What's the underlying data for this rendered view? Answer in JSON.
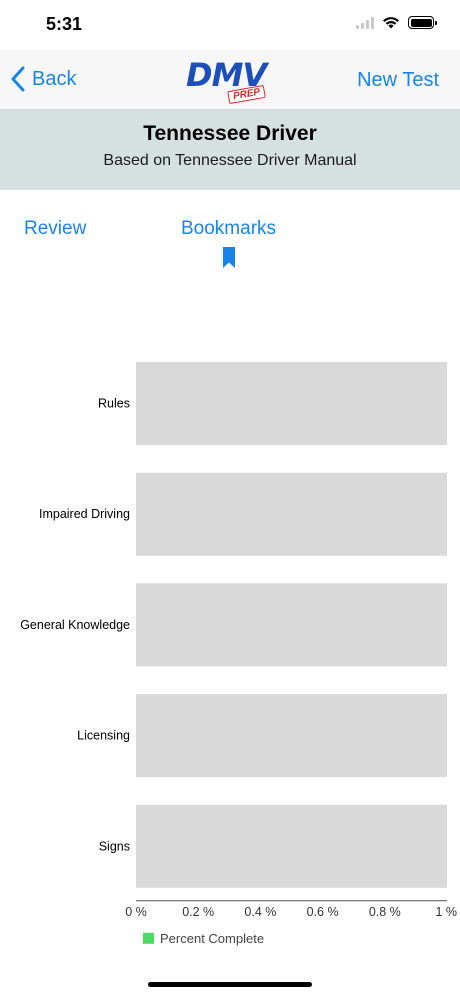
{
  "status_bar": {
    "time": "5:31"
  },
  "nav": {
    "back_label": "Back",
    "logo_text": "DMV",
    "logo_badge": "PREP",
    "new_test_label": "New Test"
  },
  "header": {
    "title": "Tennessee Driver",
    "subtitle": "Based on Tennessee Driver Manual"
  },
  "tabs": [
    {
      "label": "Review"
    },
    {
      "label": "Bookmarks"
    }
  ],
  "colors": {
    "accent": "#1a84e6",
    "banner": "#d5e0e0",
    "bar_track": "#d9d9d9",
    "complete": "#4cd964"
  },
  "chart_data": {
    "type": "bar",
    "orientation": "horizontal",
    "categories": [
      "Rules",
      "Impaired Driving",
      "General Knowledge",
      "Licensing",
      "Signs"
    ],
    "series": [
      {
        "name": "Percent Complete",
        "values": [
          0,
          0,
          0,
          0,
          0
        ]
      }
    ],
    "x_ticks": [
      "0 %",
      "0.2 %",
      "0.4 %",
      "0.6 %",
      "0.8 %",
      "1 %"
    ],
    "xlim": [
      0,
      1
    ],
    "legend": "bottom-left",
    "grid": false
  }
}
